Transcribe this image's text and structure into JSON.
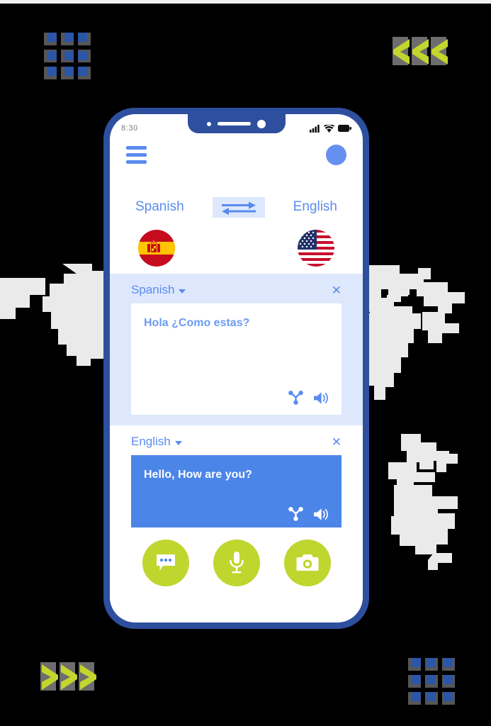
{
  "page": {
    "background_color": "#000000",
    "map_color": "#eaeaea"
  },
  "decorations": {
    "dot_grid_top_left": {
      "name": "dot-grid",
      "rows": 3,
      "cols": 3,
      "blue": "#2b56a5",
      "shadow": "#565656"
    },
    "dot_grid_bottom_right": {
      "name": "dot-grid",
      "rows": 3,
      "cols": 3,
      "blue": "#2b56a5",
      "shadow": "#565656"
    },
    "chevrons_top_right": {
      "name": "chevrons-left",
      "count": 3,
      "direction": "left",
      "color": "#c3d62e",
      "shadow": "#6d6d6d"
    },
    "chevrons_bottom_left": {
      "name": "chevrons-right",
      "count": 3,
      "direction": "right",
      "color": "#c3d62e",
      "shadow": "#6d6d6d"
    }
  },
  "phone": {
    "frame_color": "#2d4f9e",
    "status_bar": {
      "time": "8:30",
      "icons": [
        "signal-icon",
        "wifi-icon",
        "battery-icon"
      ]
    },
    "app_bar": {
      "menu_icon": "hamburger-icon",
      "avatar": "avatar",
      "accent_color": "#5b8bf0"
    },
    "language_selector": {
      "source_language": "Spanish",
      "target_language": "English",
      "swap_icon": "swap-arrows-icon",
      "swap_bg": "#dde8fd"
    },
    "flags": {
      "source_flag": "spain-flag",
      "target_flag": "usa-flag"
    },
    "source_card": {
      "language_label": "Spanish",
      "dropdown_icon": "chevron-down-icon",
      "close_icon": "close-icon",
      "close_glyph": "✕",
      "text": "Hola ¿Como estas?",
      "share_icon": "share-icon",
      "speaker_icon": "speaker-icon",
      "card_bg": "#dee8fc",
      "box_bg": "#ffffff",
      "text_color": "#6c9bf2"
    },
    "target_card": {
      "language_label": "English",
      "dropdown_icon": "chevron-down-icon",
      "close_icon": "close-icon",
      "close_glyph": "✕",
      "text": "Hello, How are you?",
      "share_icon": "share-icon",
      "speaker_icon": "speaker-icon",
      "card_bg": "#ffffff",
      "box_bg": "#4b85e8",
      "text_color": "#ffffff"
    },
    "action_bar": {
      "button_color": "#bfd62f",
      "buttons": [
        {
          "icon": "chat-bubble-icon",
          "label": "Conversation"
        },
        {
          "icon": "microphone-icon",
          "label": "Voice input"
        },
        {
          "icon": "camera-icon",
          "label": "Camera translate"
        }
      ]
    }
  }
}
